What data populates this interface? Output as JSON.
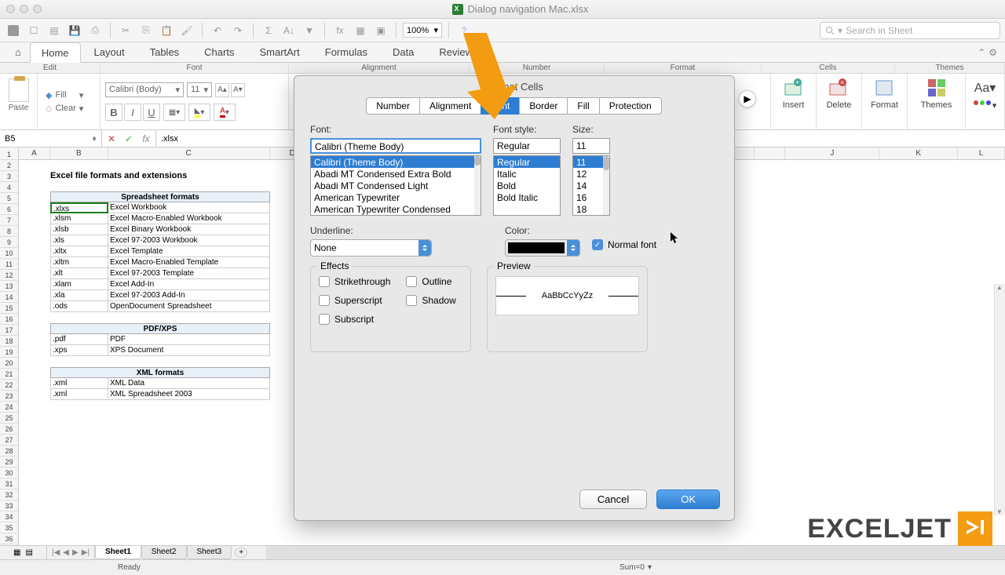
{
  "titlebar": {
    "filename": "Dialog navigation Mac.xlsx"
  },
  "qat": {
    "zoom": "100%",
    "search_placeholder": "Search in Sheet"
  },
  "ribbon": {
    "tabs": [
      "Home",
      "Layout",
      "Tables",
      "Charts",
      "SmartArt",
      "Formulas",
      "Data",
      "Review"
    ],
    "sections": {
      "edit": "Edit",
      "font": "Font",
      "alignment": "Alignment",
      "number": "Number",
      "format": "Format",
      "cells": "Cells",
      "themes": "Themes"
    },
    "paste": "Paste",
    "fill": "Fill",
    "clear": "Clear",
    "font_name": "Calibri (Body)",
    "font_size": "11",
    "insert": "Insert",
    "delete": "Delete",
    "format_btn": "Format",
    "themes_btn": "Themes"
  },
  "namebox": "B5",
  "formula": ".xlsx",
  "sheet": {
    "title": "Excel file formats and extensions",
    "sec1": "Spreadsheet formats",
    "sec2": "PDF/XPS",
    "sec3": "XML formats",
    "rows1": [
      {
        "a": ".xlxs",
        "b": "Excel Workbook"
      },
      {
        "a": ".xlsm",
        "b": "Excel Macro-Enabled Workbook"
      },
      {
        "a": ".xlsb",
        "b": "Excel Binary Workbook"
      },
      {
        "a": ".xls",
        "b": "Excel 97-2003 Workbook"
      },
      {
        "a": ".xltx",
        "b": "Excel Template"
      },
      {
        "a": ".xltm",
        "b": "Excel Macro-Enabled Template"
      },
      {
        "a": ".xlt",
        "b": "Excel 97-2003 Template"
      },
      {
        "a": ".xlam",
        "b": "Excel Add-In"
      },
      {
        "a": ".xla",
        "b": "Excel 97-2003 Add-In"
      },
      {
        "a": ".ods",
        "b": "OpenDocument Spreadsheet"
      }
    ],
    "rows2": [
      {
        "a": ".pdf",
        "b": "PDF"
      },
      {
        "a": ".xps",
        "b": "XPS Document"
      }
    ],
    "rows3": [
      {
        "a": ".xml",
        "b": "XML Data"
      },
      {
        "a": ".xml",
        "b": "XML Spreadsheet 2003"
      }
    ],
    "tabs": [
      "Sheet1",
      "Sheet2",
      "Sheet3"
    ]
  },
  "status": {
    "ready": "Ready",
    "sum": "Sum=0"
  },
  "dialog": {
    "title": "Format Cells",
    "tabs": [
      "Number",
      "Alignment",
      "Font",
      "Border",
      "Fill",
      "Protection"
    ],
    "font_label": "Font:",
    "font_value": "Calibri (Theme Body)",
    "font_list": [
      "Calibri (Theme Body)",
      "Abadi MT Condensed Extra Bold",
      "Abadi MT Condensed Light",
      "American Typewriter",
      "American Typewriter Condensed"
    ],
    "style_label": "Font style:",
    "style_value": "Regular",
    "style_list": [
      "Regular",
      "Italic",
      "Bold",
      "Bold Italic"
    ],
    "size_label": "Size:",
    "size_value": "11",
    "size_list": [
      "11",
      "12",
      "14",
      "16",
      "18"
    ],
    "underline_label": "Underline:",
    "underline_value": "None",
    "color_label": "Color:",
    "normal_font": "Normal font",
    "effects_label": "Effects",
    "effect_strike": "Strikethrough",
    "effect_outline": "Outline",
    "effect_super": "Superscript",
    "effect_shadow": "Shadow",
    "effect_sub": "Subscript",
    "preview_label": "Preview",
    "preview_text": "AaBbCcYyZz",
    "cancel": "Cancel",
    "ok": "OK"
  },
  "logo": "EXCELJET"
}
